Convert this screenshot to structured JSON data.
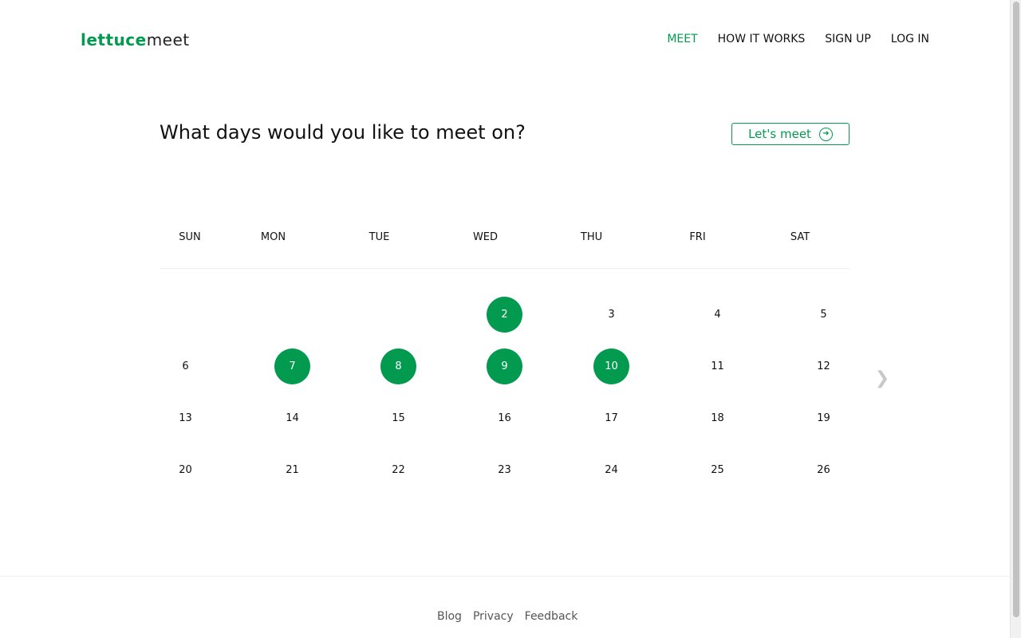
{
  "logo": {
    "part1": "lettuce",
    "part2": "meet"
  },
  "nav": {
    "items": [
      {
        "label": "MEET",
        "active": true
      },
      {
        "label": "HOW IT WORKS",
        "active": false
      },
      {
        "label": "SIGN UP",
        "active": false
      },
      {
        "label": "LOG IN",
        "active": false
      }
    ]
  },
  "main": {
    "title": "What days would you like to meet on?",
    "meet_button_label": "Let's meet",
    "accent_color": "#029a4f"
  },
  "calendar": {
    "weekdays": [
      "SUN",
      "MON",
      "TUE",
      "WED",
      "THU",
      "FRI",
      "SAT"
    ],
    "weeks": [
      [
        null,
        null,
        null,
        "2",
        "3",
        "4",
        "5"
      ],
      [
        "6",
        "7",
        "8",
        "9",
        "10",
        "11",
        "12"
      ],
      [
        "13",
        "14",
        "15",
        "16",
        "17",
        "18",
        "19"
      ],
      [
        "20",
        "21",
        "22",
        "23",
        "24",
        "25",
        "26"
      ]
    ],
    "selected": [
      "2",
      "7",
      "8",
      "9",
      "10"
    ],
    "next_icon": "chevron-right-icon"
  },
  "footer": {
    "links": [
      "Blog",
      "Privacy",
      "Feedback"
    ]
  }
}
